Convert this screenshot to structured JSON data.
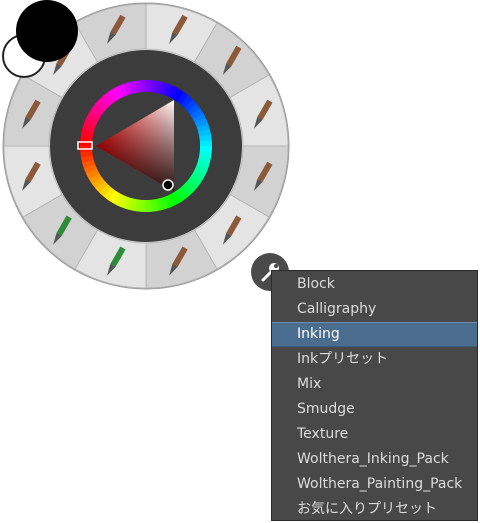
{
  "colors": {
    "foreground": "#000000",
    "background": "#ffffff",
    "palette_ring": "#3c3c3c",
    "menu_bg": "#484848",
    "menu_highlight": "#4a6c8f"
  },
  "preset_slots": [
    {
      "icon": "inking-pen-icon"
    },
    {
      "icon": "inking-pen-icon"
    },
    {
      "icon": "marker-icon"
    },
    {
      "icon": "round-brush-icon"
    },
    {
      "icon": "inking-pen-icon"
    },
    {
      "icon": "inking-pen-icon"
    },
    {
      "icon": "green-marker-icon"
    },
    {
      "icon": "green-marker-icon"
    },
    {
      "icon": "inking-pen-icon"
    },
    {
      "icon": "ink-brush-icon"
    },
    {
      "icon": "ink-brush-icon"
    },
    {
      "icon": "marker-icon"
    }
  ],
  "settings_button": {
    "icon": "wrench-icon"
  },
  "tag_menu": {
    "items": [
      {
        "label": "Block"
      },
      {
        "label": "Calligraphy"
      },
      {
        "label": "Inking",
        "active": true
      },
      {
        "label": "Inkプリセット"
      },
      {
        "label": "Mix"
      },
      {
        "label": "Smudge"
      },
      {
        "label": "Texture"
      },
      {
        "label": "Wolthera_Inking_Pack"
      },
      {
        "label": "Wolthera_Painting_Pack"
      },
      {
        "label": "お気に入りプリセット"
      }
    ]
  }
}
